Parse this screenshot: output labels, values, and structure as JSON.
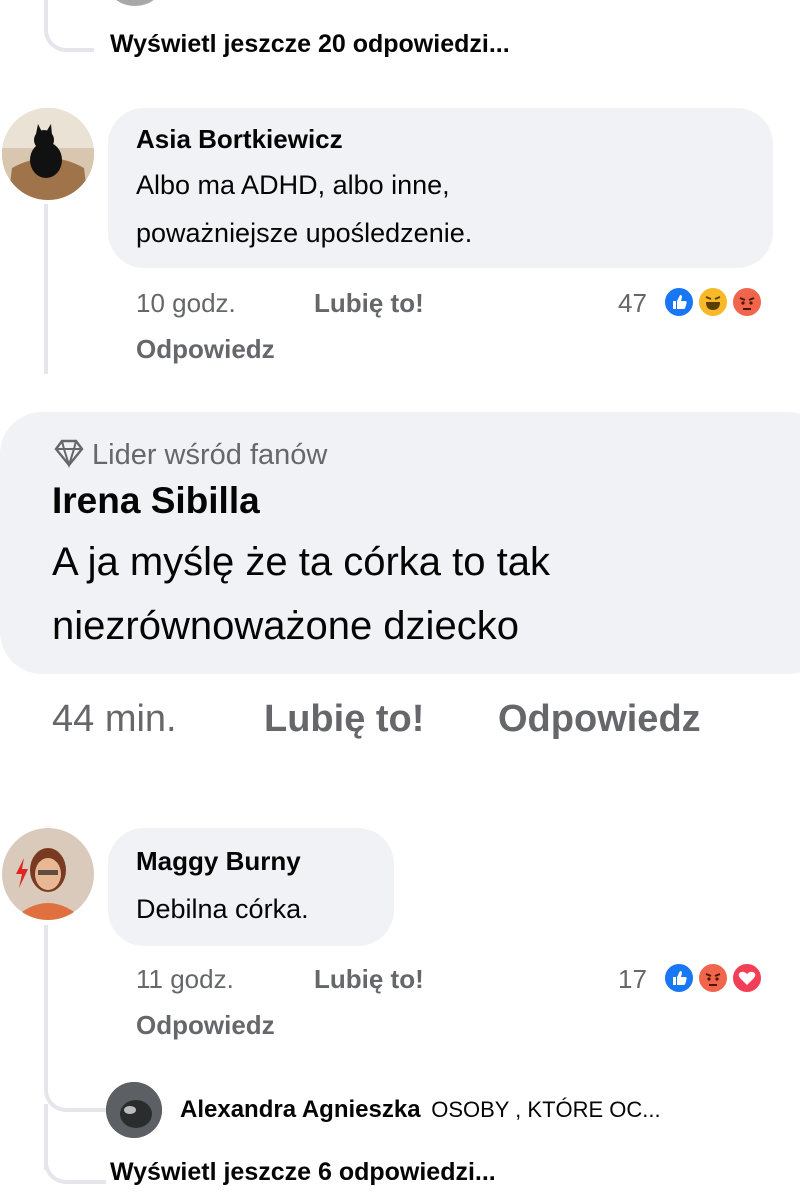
{
  "top_thread": {
    "more_replies": "Wyświetl jeszcze 20 odpowiedzi..."
  },
  "comment1": {
    "author": "Asia Bortkiewicz",
    "text_line1": "Albo ma ADHD, albo inne,",
    "text_line2": "poważniejsze upośledzenie.",
    "time": "10 godz.",
    "like": "Lubię to!",
    "reply": "Odpowiedz",
    "reaction_count": "47",
    "reactions": [
      "like-icon",
      "haha-icon",
      "angry-icon"
    ]
  },
  "comment2": {
    "badge": "Lider wśród fanów",
    "author": "Irena Sibilla",
    "text_line1": "A ja myślę że ta córka to tak",
    "text_line2": "niezrównoważone dziecko",
    "time": "44 min.",
    "like": "Lubię to!",
    "reply": "Odpowiedz"
  },
  "comment3": {
    "author": "Maggy Burny",
    "text": "Debilna córka.",
    "time": "11 godz.",
    "like": "Lubię to!",
    "reply": "Odpowiedz",
    "reaction_count": "17",
    "reactions": [
      "like-icon",
      "angry-icon",
      "love-icon"
    ]
  },
  "reply_preview": {
    "author": "Alexandra Agnieszka",
    "text": "OSOBY , KTÓRE OC..."
  },
  "bottom_thread": {
    "more_replies": "Wyświetl jeszcze 6 odpowiedzi..."
  },
  "colors": {
    "bubble": "#f0f2f5",
    "meta": "#65676b",
    "like": "#1877f2",
    "angry": "#f0654b",
    "haha": "#f7b928",
    "love": "#f33e58"
  }
}
